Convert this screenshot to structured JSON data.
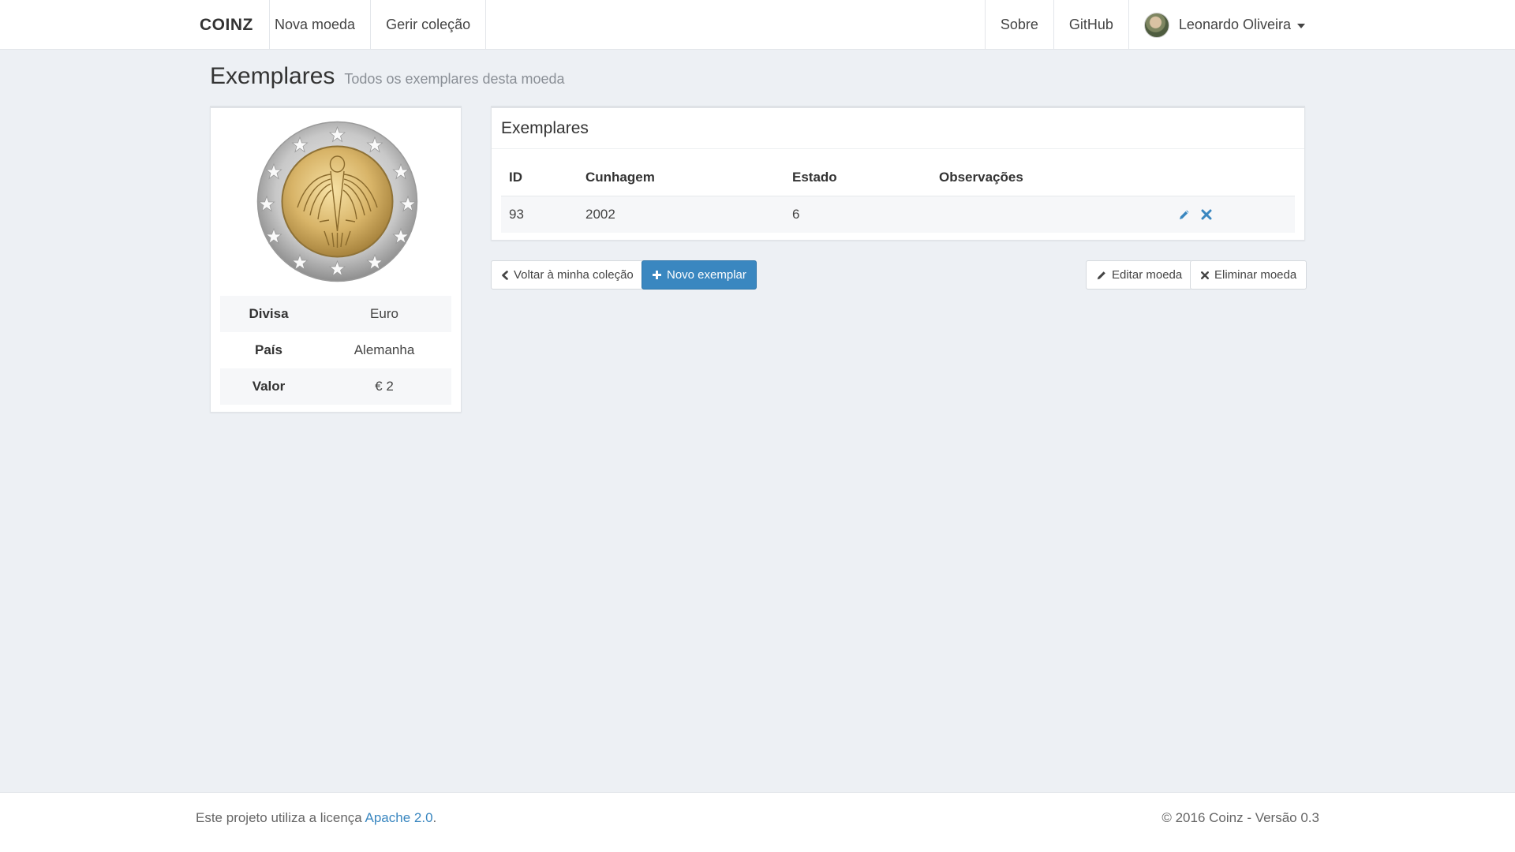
{
  "navbar": {
    "brand": "COINZ",
    "left_items": [
      "Nova moeda",
      "Gerir coleção"
    ],
    "right_items": [
      "Sobre",
      "GitHub"
    ],
    "user_name": "Leonardo Oliveira"
  },
  "header": {
    "title": "Exemplares",
    "subtitle": "Todos os exemplares desta moeda"
  },
  "coin": {
    "image_icon": "euro-coin-image",
    "rows": [
      {
        "label": "Divisa",
        "value": "Euro"
      },
      {
        "label": "País",
        "value": "Alemanha"
      },
      {
        "label": "Valor",
        "value": "€ 2"
      }
    ]
  },
  "exemplares": {
    "panel_title": "Exemplares",
    "columns": [
      "ID",
      "Cunhagem",
      "Estado",
      "Observações"
    ],
    "rows": [
      {
        "id": "93",
        "cunhagem": "2002",
        "estado": "6",
        "observacoes": ""
      }
    ]
  },
  "buttons": {
    "back": "Voltar à minha coleção",
    "new_exemplar": "Novo exemplar",
    "edit_coin": "Editar moeda",
    "delete_coin": "Eliminar moeda"
  },
  "footer": {
    "license_prefix": "Este projeto utiliza a licença ",
    "license_link": "Apache 2.0",
    "license_suffix": ".",
    "copyright": "© 2016 Coinz - Versão 0.3"
  },
  "colors": {
    "primary": "#3a87c0",
    "background": "#edf0f4"
  }
}
